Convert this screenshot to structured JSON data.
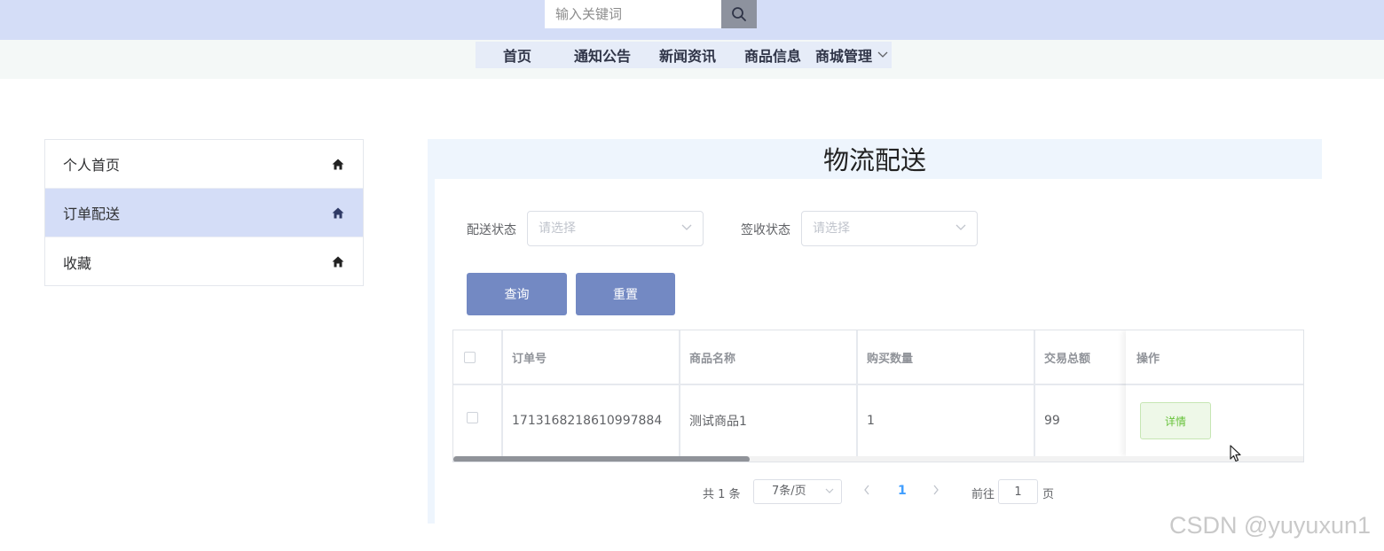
{
  "header": {
    "search_placeholder": "输入关键词"
  },
  "nav": {
    "items": [
      {
        "label": "首页"
      },
      {
        "label": "通知公告"
      },
      {
        "label": "新闻资讯"
      },
      {
        "label": "商品信息"
      },
      {
        "label": "商城管理"
      }
    ]
  },
  "sidebar": {
    "items": [
      {
        "label": "个人首页",
        "active": false
      },
      {
        "label": "订单配送",
        "active": true
      },
      {
        "label": "收藏",
        "active": false
      }
    ]
  },
  "main": {
    "title": "物流配送",
    "filters": [
      {
        "label": "配送状态",
        "placeholder": "请选择"
      },
      {
        "label": "签收状态",
        "placeholder": "请选择"
      }
    ],
    "buttons": {
      "query": "查询",
      "reset": "重置"
    },
    "table": {
      "columns": [
        "订单号",
        "商品名称",
        "购买数量",
        "交易总额",
        "操作"
      ],
      "rows": [
        {
          "order_no": "1713168218610997884",
          "product_name": "测试商品1",
          "quantity": "1",
          "total": "99",
          "action": "详情"
        }
      ]
    },
    "pagination": {
      "total_text": "共 1 条",
      "page_size": "7条/页",
      "current_page": "1",
      "goto_label": "前往",
      "goto_value": "1",
      "page_suffix": "页"
    }
  },
  "watermark": "CSDN @yuyuxun1",
  "colors": {
    "topbar": "#d4ddf7",
    "accent_button": "#7389c3",
    "active_sidebar": "#d4ddf7",
    "detail_button_text": "#67c23a",
    "page_active": "#409eff"
  }
}
